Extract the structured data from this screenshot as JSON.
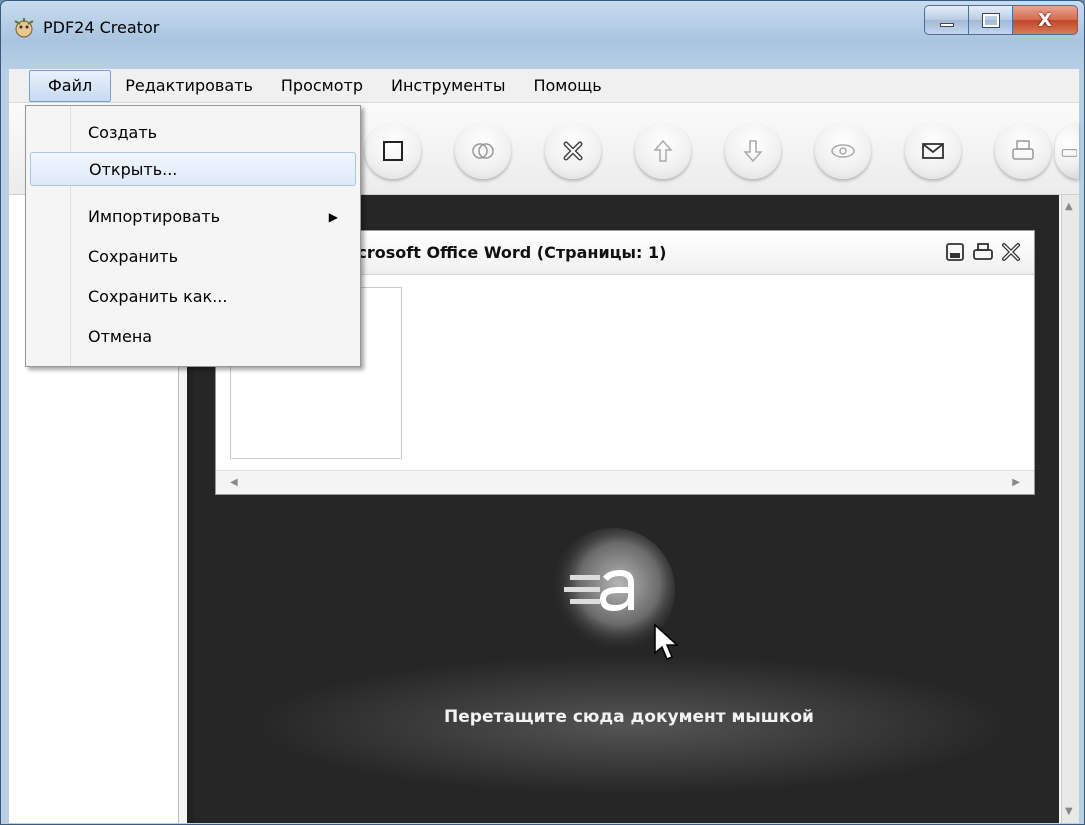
{
  "window": {
    "title": "PDF24 Creator",
    "close_glyph": "X"
  },
  "menubar": {
    "items": [
      "Файл",
      "Редактировать",
      "Просмотр",
      "Инструменты",
      "Помощь"
    ]
  },
  "file_menu": {
    "items": [
      "Создать",
      "Открыть...",
      "Импортировать",
      "Сохранить",
      "Сохранить как...",
      "Отмена"
    ],
    "highlighted": "Открыть..."
  },
  "toolbar": {
    "icons": [
      "new-page-icon",
      "merge-icon",
      "delete-icon",
      "move-up-icon",
      "move-down-icon",
      "preview-icon",
      "email-icon",
      "print-icon",
      "printer-icon"
    ]
  },
  "document": {
    "title": "Microsoft Office Word (Страницы: 1)"
  },
  "drop_area": {
    "text": "Перетащите сюда документ мышкой"
  },
  "colors": {
    "workspace": "#262626",
    "menu_highlight": "#dde9f8",
    "close_button": "#c04627"
  }
}
